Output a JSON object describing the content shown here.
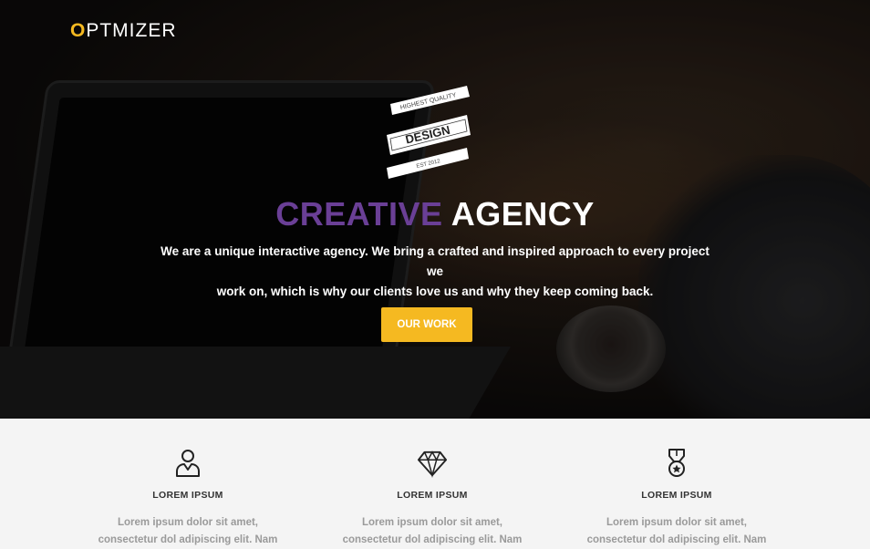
{
  "logo": {
    "first_letter": "O",
    "rest": "PTMIZER"
  },
  "badge": {
    "top_text": "HIGHEST QUALITY",
    "main_text": "DESIGN",
    "bottom_text": "EST 2012"
  },
  "hero": {
    "headline_part1": "CREATIVE",
    "headline_part2": " AGENCY",
    "description_line1": "We are a unique interactive agency. We bring a crafted and inspired approach to every project we",
    "description_line2": "work on, which is why our clients love us and why they keep coming back.",
    "cta_label": "OUR WORK"
  },
  "features": [
    {
      "icon": "person-icon",
      "title": "LOREM IPSUM",
      "line1": "Lorem ipsum dolor sit amet,",
      "line2": "consectetur dol adipiscing elit. Nam"
    },
    {
      "icon": "diamond-icon",
      "title": "LOREM IPSUM",
      "line1": "Lorem ipsum dolor sit amet,",
      "line2": "consectetur dol adipiscing elit. Nam"
    },
    {
      "icon": "medal-icon",
      "title": "LOREM IPSUM",
      "line1": "Lorem ipsum dolor sit amet,",
      "line2": "consectetur dol adipiscing elit. Nam"
    }
  ],
  "colors": {
    "accent": "#f5b921",
    "purple": "#6a3f96",
    "section_bg": "#f4f4f4"
  }
}
